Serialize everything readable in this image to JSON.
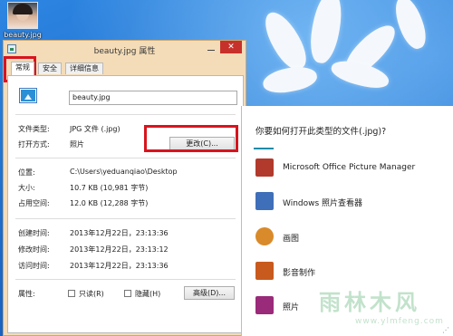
{
  "desktop": {
    "icon_label": "beauty.jpg"
  },
  "dialog": {
    "title": "beauty.jpg 属性",
    "close_glyph": "✕",
    "tabs": [
      {
        "label": "常规"
      },
      {
        "label": "安全"
      },
      {
        "label": "详细信息"
      }
    ],
    "filename": "beauty.jpg",
    "file_type_label": "文件类型:",
    "file_type_value": "JPG 文件 (.jpg)",
    "opens_with_label": "打开方式:",
    "opens_with_value": "照片",
    "change_button": "更改(C)...",
    "location_label": "位置:",
    "location_value": "C:\\Users\\yeduanqiao\\Desktop",
    "size_label": "大小:",
    "size_value": "10.7 KB (10,981 字节)",
    "size_on_disk_label": "占用空间:",
    "size_on_disk_value": "12.0 KB (12,288 字节)",
    "created_label": "创建时间:",
    "created_value": "2013年12月22日，23:13:36",
    "modified_label": "修改时间:",
    "modified_value": "2013年12月22日，23:13:12",
    "accessed_label": "访问时间:",
    "accessed_value": "2013年12月22日，23:13:36",
    "attributes_label": "属性:",
    "readonly_label": "只读(R)",
    "hidden_label": "隐藏(H)",
    "advanced_button": "高级(D)..."
  },
  "open_with": {
    "question": "你要如何打开此类型的文件(.jpg)?",
    "apps": [
      {
        "label": "Microsoft Office Picture Manager",
        "icon": "picture-manager-icon",
        "color": "#b23a2c"
      },
      {
        "label": "Windows 照片查看器",
        "icon": "photo-viewer-icon",
        "color": "#3f6fb8"
      },
      {
        "label": "画图",
        "icon": "paint-icon",
        "color": "#d98a2a"
      },
      {
        "label": "影音制作",
        "icon": "movie-maker-icon",
        "color": "#c85a1e"
      },
      {
        "label": "照片",
        "icon": "photos-icon",
        "color": "#9a2a7a"
      }
    ]
  },
  "watermark": {
    "text": "雨林木风",
    "url": "www.ylmfeng.com"
  },
  "colors": {
    "highlight_box": "#d8141e",
    "accent": "#1e8ca8",
    "close_button": "#c7312b"
  }
}
